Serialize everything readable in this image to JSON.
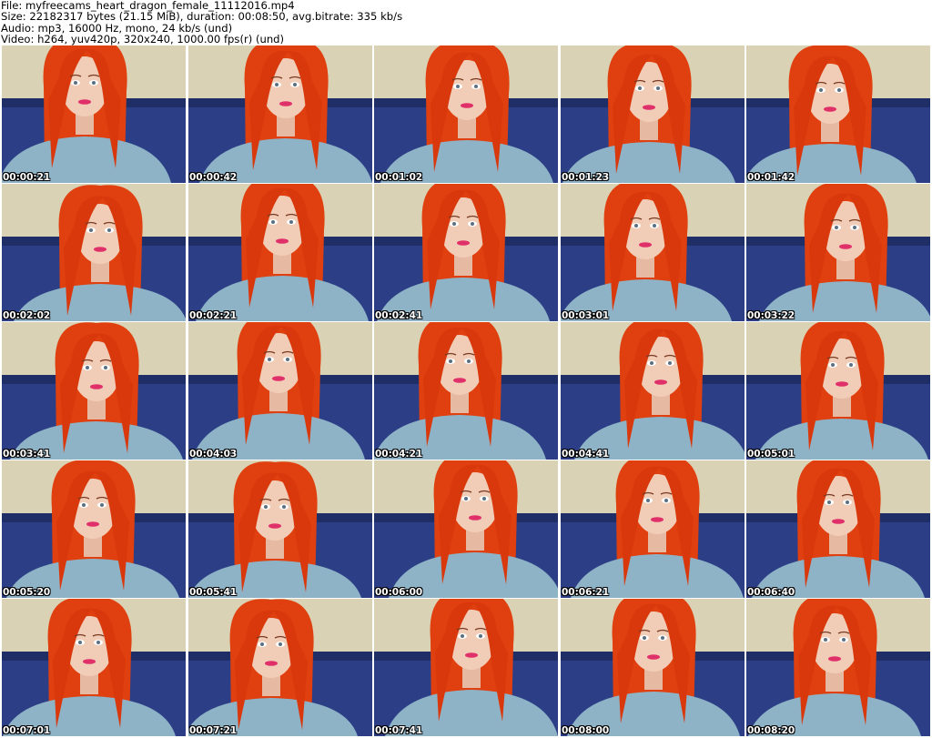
{
  "header": {
    "file": "File: myfreecams_heart_dragon_female_11112016.mp4",
    "size": "Size: 22182317 bytes (21.15 MiB), duration: 00:08:50, avg.bitrate: 335 kb/s",
    "audio": "Audio: mp3, 16000 Hz, mono, 24 kb/s (und)",
    "video": "Video: h264, yuv420p, 320x240, 1000.00 fps(r) (und)"
  },
  "thumbnails": [
    {
      "time": "00:00:21"
    },
    {
      "time": "00:00:42"
    },
    {
      "time": "00:01:02"
    },
    {
      "time": "00:01:23"
    },
    {
      "time": "00:01:42"
    },
    {
      "time": "00:02:02"
    },
    {
      "time": "00:02:21"
    },
    {
      "time": "00:02:41"
    },
    {
      "time": "00:03:01"
    },
    {
      "time": "00:03:22"
    },
    {
      "time": "00:03:41"
    },
    {
      "time": "00:04:03"
    },
    {
      "time": "00:04:21"
    },
    {
      "time": "00:04:41"
    },
    {
      "time": "00:05:01"
    },
    {
      "time": "00:05:20"
    },
    {
      "time": "00:05:41"
    },
    {
      "time": "00:06:00"
    },
    {
      "time": "00:06:21"
    },
    {
      "time": "00:06:40"
    },
    {
      "time": "00:07:01"
    },
    {
      "time": "00:07:21"
    },
    {
      "time": "00:07:41"
    },
    {
      "time": "00:08:00"
    },
    {
      "time": "00:08:20"
    }
  ],
  "colors": {
    "background": "#ffffff",
    "wall": "#d9d2b4",
    "sofa": "#2c3f86",
    "hair": "#e0400f",
    "skin": "#f1cdb8",
    "shirt": "#8eb3c7",
    "lips": "#e0306a"
  }
}
